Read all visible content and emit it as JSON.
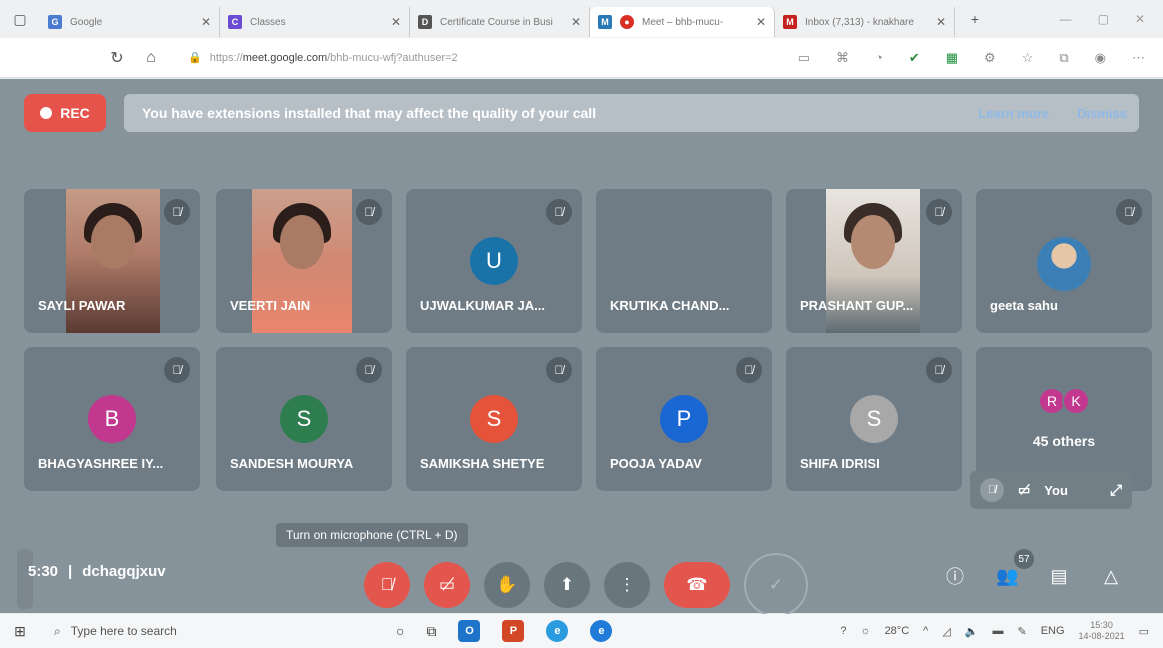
{
  "browser": {
    "tabs": [
      {
        "label": "Google",
        "icon": "google-icon",
        "color": "#4a7bd1"
      },
      {
        "label": "Classes",
        "icon": "classes-icon",
        "color": "#6b4bd1"
      },
      {
        "label": "Certificate Course in Busi",
        "icon": "document-icon",
        "color": "#555555"
      },
      {
        "label": "Meet – bhb-mucu-",
        "icon": "meet-icon",
        "color": "#d93025"
      },
      {
        "label": "Inbox (7,313) - knakhare",
        "icon": "gmail-icon",
        "color": "#c5221f"
      }
    ],
    "url_prefix": "https://",
    "url_domain": "meet.google.com",
    "url_path": "/bhb-mucu-wfj?authuser=2"
  },
  "meet": {
    "rec_label": "REC",
    "banner_text": "You have extensions installed that may affect the quality of your call",
    "learn_more": "Learn more",
    "dismiss": "Dismiss",
    "participants": [
      {
        "name": "SAYLI PAWAR",
        "kind": "video"
      },
      {
        "name": "VEERTI JAIN",
        "kind": "video"
      },
      {
        "name": "UJWALKUMAR JA...",
        "kind": "avatar",
        "initial": "U",
        "color": "#1a73a8"
      },
      {
        "name": "KRUTIKA CHAND...",
        "kind": "blank"
      },
      {
        "name": "PRASHANT GUP...",
        "kind": "video"
      },
      {
        "name": "geeta sahu",
        "kind": "photo"
      },
      {
        "name": "BHAGYASHREE IY...",
        "kind": "avatar",
        "initial": "B",
        "color": "#c2388f"
      },
      {
        "name": "SANDESH MOURYA",
        "kind": "avatar",
        "initial": "S",
        "color": "#2e7d4f"
      },
      {
        "name": "SAMIKSHA SHETYE",
        "kind": "avatar",
        "initial": "S",
        "color": "#e5533b"
      },
      {
        "name": "POOJA YADAV",
        "kind": "avatar",
        "initial": "P",
        "color": "#1967d2"
      },
      {
        "name": "SHIFA IDRISI",
        "kind": "avatar",
        "initial": "S",
        "color": "#a8a8a8"
      }
    ],
    "others": {
      "initials": [
        "R",
        "K"
      ],
      "colors": [
        "#c2388f",
        "#c2388f"
      ],
      "label": "45 others"
    },
    "self_label": "You",
    "tooltip": "Turn on microphone (CTRL + D)",
    "time": "5:30",
    "meeting_code": "dchagqjxuv",
    "people_count": "57"
  },
  "taskbar": {
    "search_placeholder": "Type here to search",
    "temperature": "28°C",
    "language": "ENG",
    "time": "15:30",
    "date": "14-08-2021"
  }
}
